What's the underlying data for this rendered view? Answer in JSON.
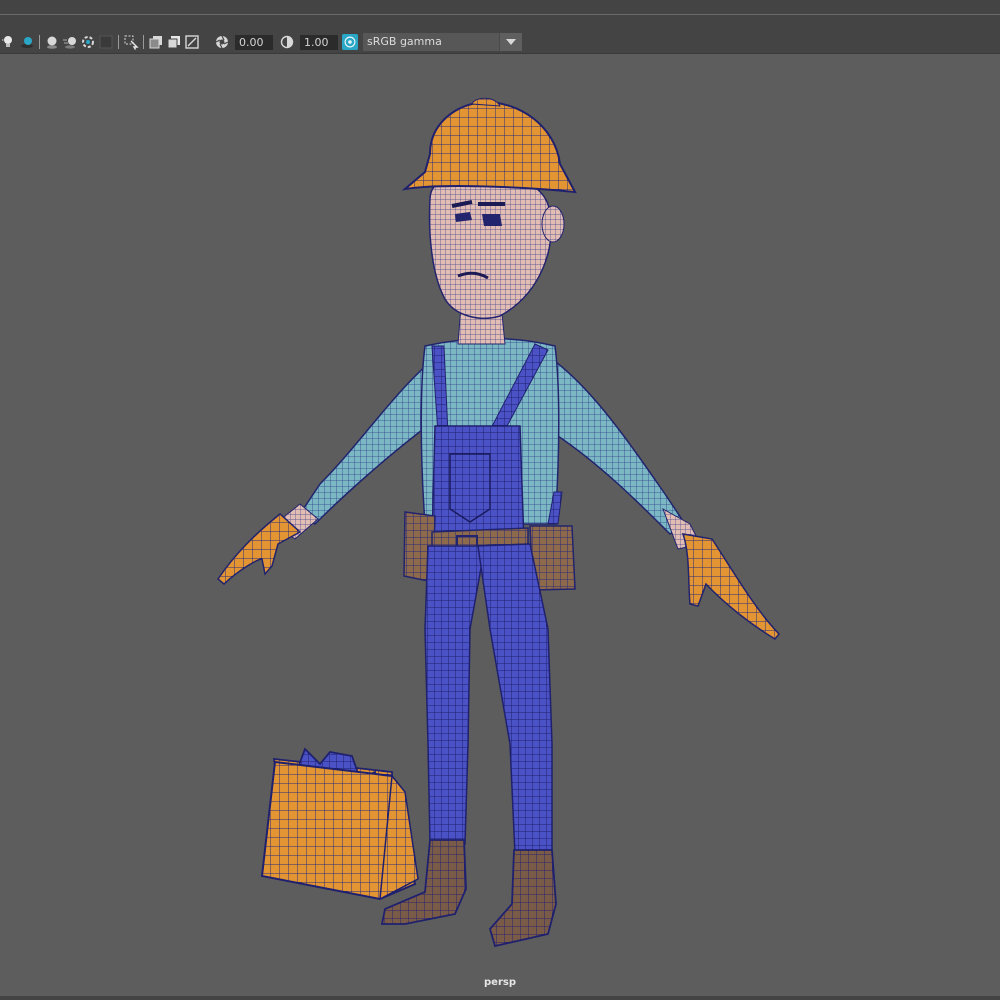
{
  "toolbar": {
    "exposure_value": "0.00",
    "gamma_value": "1.00",
    "color_space": "sRGB gamma",
    "icons": [
      "light-bulb-icon",
      "shadow-sphere-icon",
      "separator",
      "ambient-occlusion-icon",
      "motion-blur-icon",
      "anti-aliasing-icon",
      "depth-of-field-icon",
      "separator",
      "isolate-select-icon",
      "separator",
      "xray-icon",
      "xray-joints-icon",
      "xray-components-icon",
      "exposure-icon",
      "gamma-icon",
      "color-management-icon"
    ]
  },
  "viewport": {
    "camera_name": "persp"
  },
  "colors": {
    "panel_bg": "#444444",
    "viewport_bg": "#5d5d5d",
    "field_bg": "#2b2b2b",
    "accent": "#2aa6c7",
    "wire": "#2a2a8a",
    "overalls": "#4a52c4",
    "shirt": "#79b7c2",
    "helmet": "#e0922e",
    "skin": "#e2bfb6"
  }
}
